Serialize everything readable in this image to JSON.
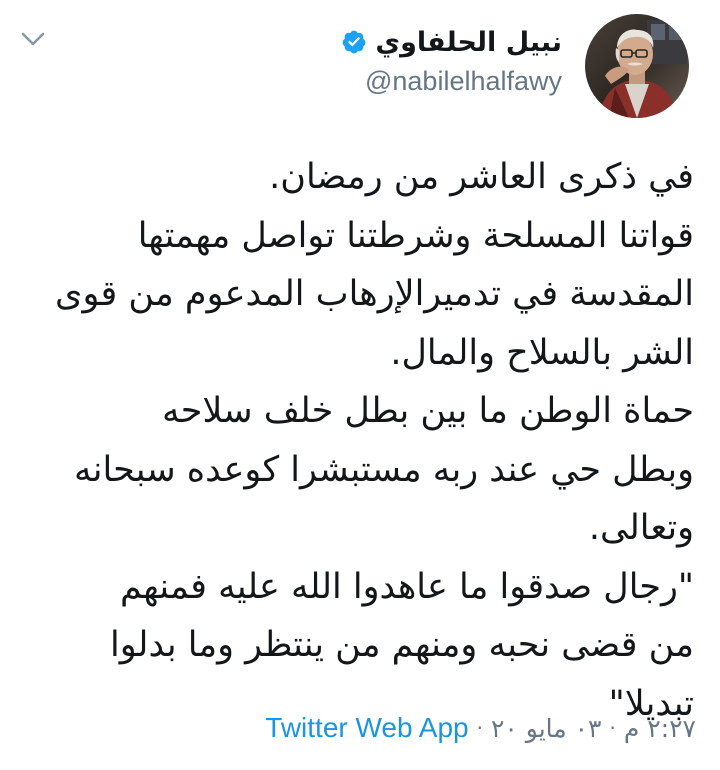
{
  "user": {
    "display_name": "نبيل الحلفاوي",
    "handle": "@nabilelhalfawy",
    "verified": true
  },
  "tweet": {
    "lines": [
      "في ذكرى العاشر من رمضان.",
      "قواتنا المسلحة وشرطتنا تواصل مهمتها",
      "المقدسة في تدميرالإرهاب المدعوم من قوى",
      "الشر بالسلاح والمال.",
      "حماة الوطن ما بين بطل خلف سلاحه",
      "وبطل حي عند ربه مستبشرا كوعده سبحانه",
      "وتعالى.",
      "\"رجال صدقوا ما عاهدوا الله عليه فمنهم",
      "من قضى نحبه ومنهم من ينتظر وما بدلوا",
      "تبديلا\""
    ],
    "time": "٢:٢٧ م",
    "date": "٠٣ مايو ٢٠",
    "source": "Twitter Web App"
  },
  "colors": {
    "verified_badge": "#1da1f2",
    "link": "#1b95e0",
    "muted": "#657786",
    "text": "#14171a"
  },
  "icons": {
    "menu": "chevron-down-icon",
    "verified": "verified-badge-icon"
  }
}
